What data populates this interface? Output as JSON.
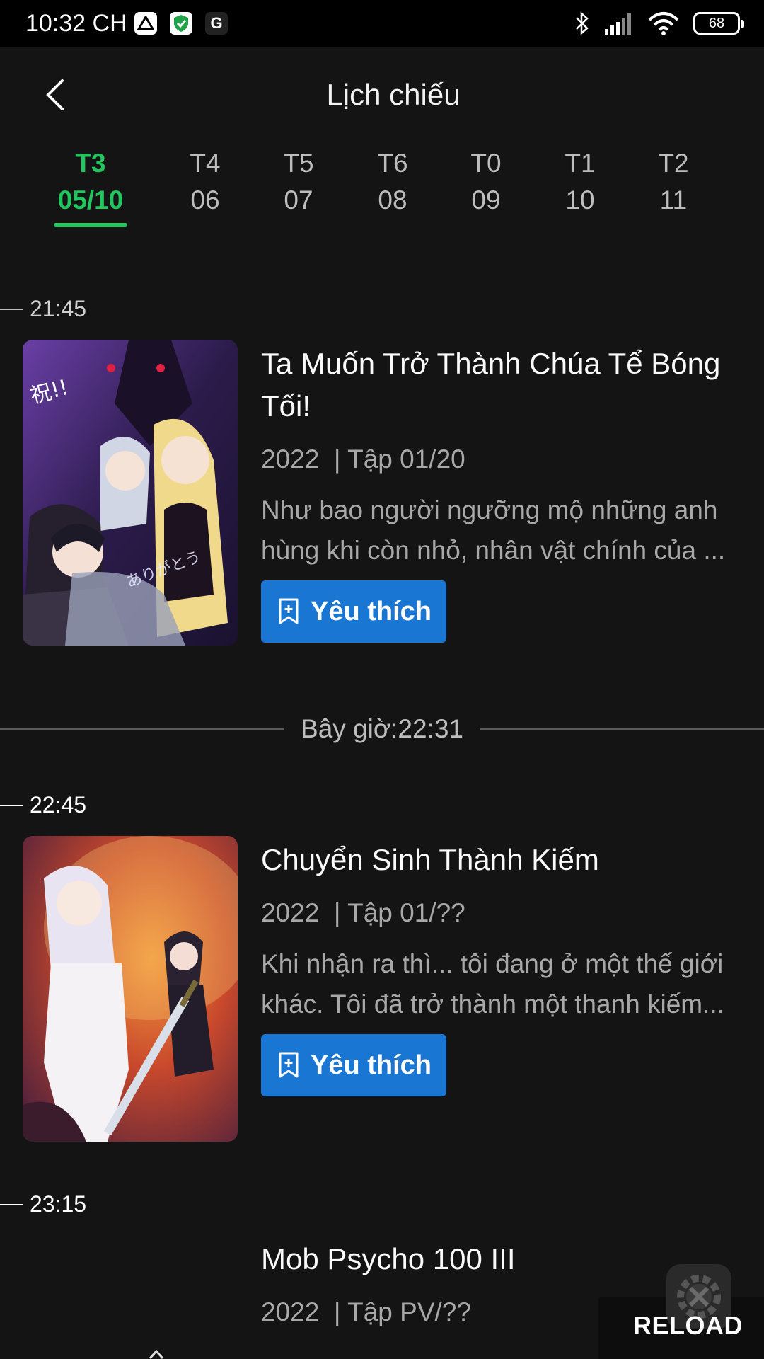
{
  "status_bar": {
    "time": "10:32 CH",
    "battery": "68",
    "apps": [
      "drive-icon",
      "shield-check-icon",
      "google-icon"
    ]
  },
  "header": {
    "title": "Lịch chiếu"
  },
  "tabs": [
    {
      "day": "T3",
      "date": "05/10",
      "active": true
    },
    {
      "day": "T4",
      "date": "06",
      "active": false
    },
    {
      "day": "T5",
      "date": "07",
      "active": false
    },
    {
      "day": "T6",
      "date": "08",
      "active": false
    },
    {
      "day": "T0",
      "date": "09",
      "active": false
    },
    {
      "day": "T1",
      "date": "10",
      "active": false
    },
    {
      "day": "T2",
      "date": "11",
      "active": false
    }
  ],
  "now_label": "Bây giờ:22:31",
  "schedule": [
    {
      "time": "21:45",
      "title": "Ta Muốn Trở Thành Chúa Tể Bóng Tối!",
      "year": "2022",
      "episode": "| Tập 01/20",
      "description_line1": "Như bao người ngưỡng mộ những anh",
      "description_line2": "hùng khi còn nhỏ, nhân vật chính của ...",
      "fav_label": "Yêu thích"
    },
    {
      "time": "22:45",
      "title": "Chuyển Sinh Thành Kiếm",
      "year": "2022",
      "episode": "| Tập 01/??",
      "description_line1": "Khi nhận ra thì... tôi đang ở một thế giới",
      "description_line2": "khác. Tôi đã trở thành một thanh kiếm...",
      "fav_label": "Yêu thích"
    },
    {
      "time": "23:15",
      "title": "Mob Psycho 100 III",
      "year": "2022",
      "episode": "| Tập PV/??"
    }
  ],
  "reload_label": "RELOAD",
  "colors": {
    "accent_green": "#22c55e",
    "button_blue": "#1976d2",
    "background": "#141414"
  }
}
